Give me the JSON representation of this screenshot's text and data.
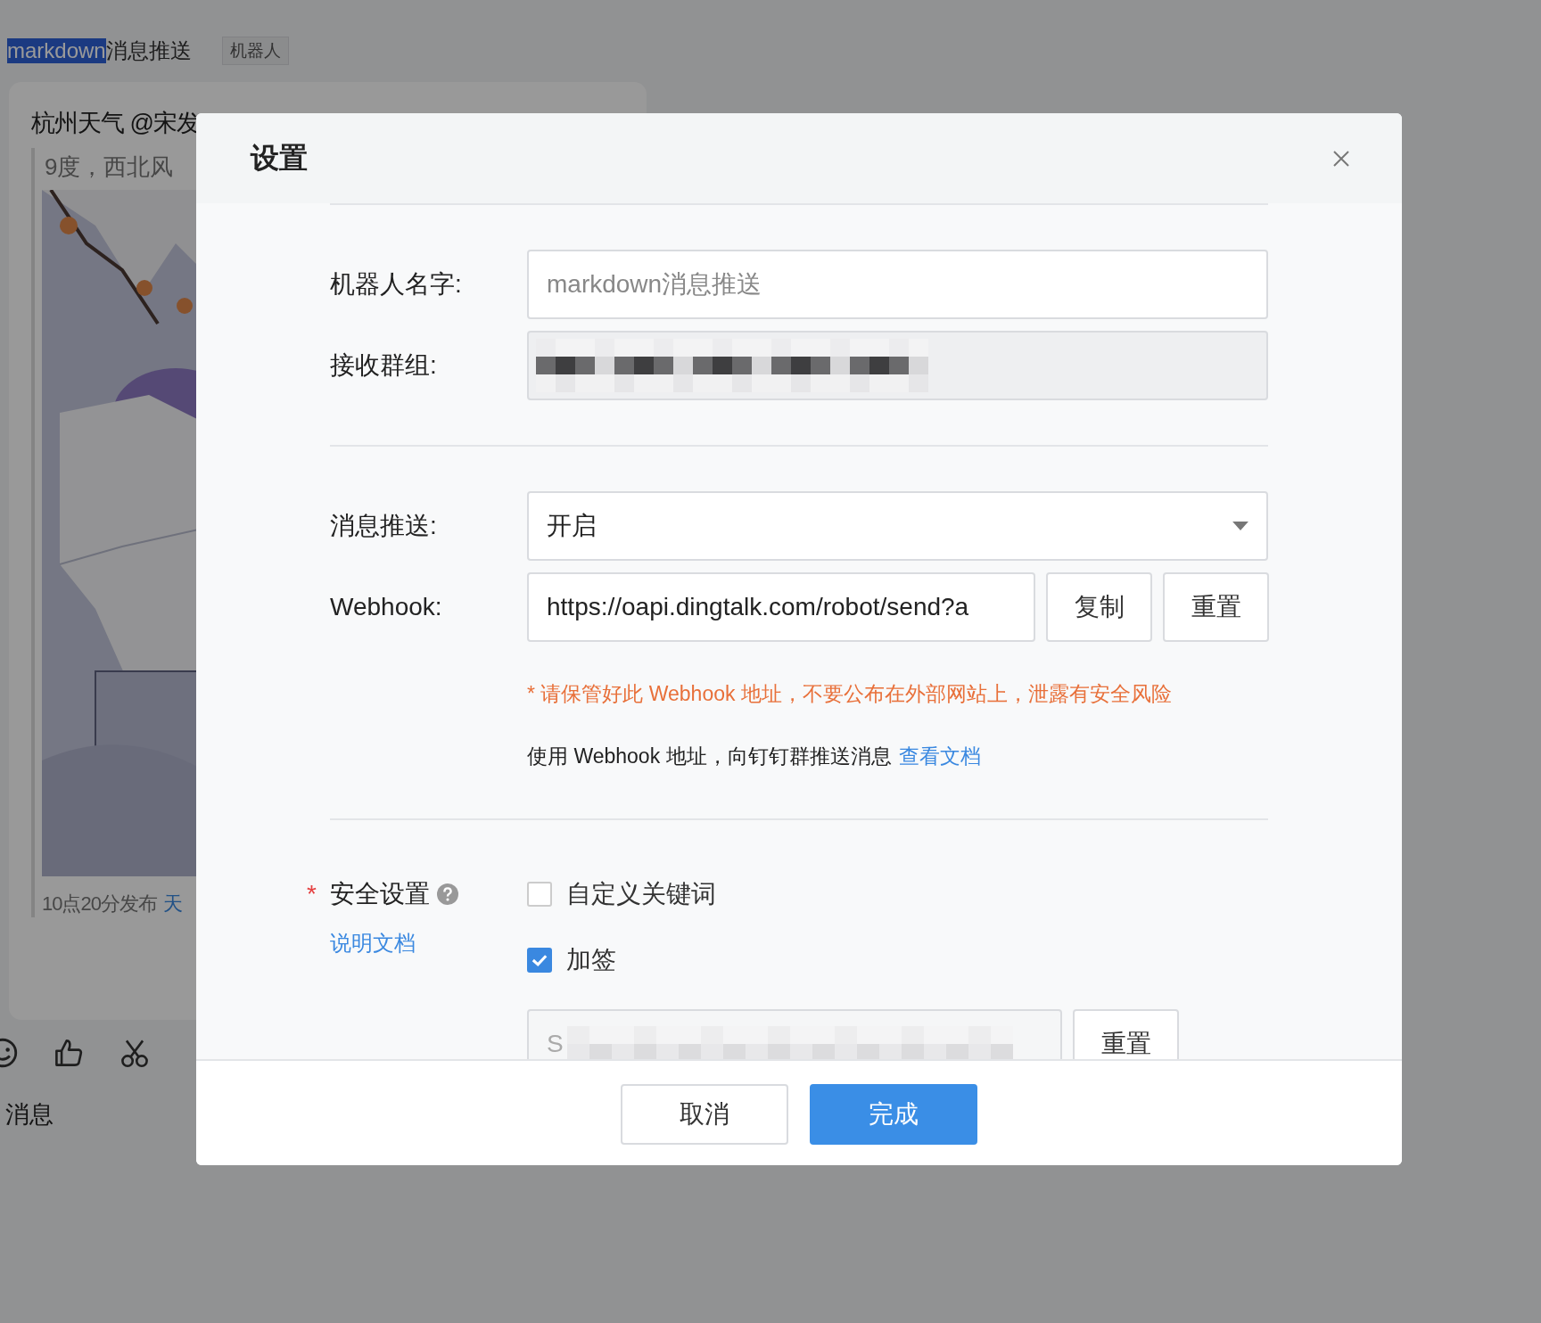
{
  "background_page": {
    "heading": [
      {
        "text": "markdown",
        "selected": true
      },
      {
        "text": "消息推送",
        "selected": false
      }
    ],
    "tag": "机器人",
    "message": {
      "title": "杭州天气 @宋发",
      "text": "9度，西北风",
      "footer": "10点20分发布",
      "footer_link": "天"
    },
    "composer_hint": "消息"
  },
  "dialog": {
    "title": "设置",
    "fields": [
      {
        "kind": "text",
        "label": "机器人名字:",
        "placeholder": "markdown消息推送"
      },
      {
        "kind": "redacted",
        "label": "接收群组:",
        "disabled": true
      }
    ],
    "push": {
      "label": "消息推送:",
      "value": "开启"
    },
    "webhook": {
      "label": "Webhook:",
      "value": "https://oapi.dingtalk.com/robot/send?a",
      "buttons": [
        "复制",
        "重置"
      ],
      "warning": "* 请保管好此 Webhook 地址，不要公布在外部网站上，泄露有安全风险",
      "usage": "使用 Webhook 地址，向钉钉群推送消息",
      "usage_link": "查看文档"
    },
    "security": {
      "label": "安全设置",
      "required_mark": "*",
      "doc_link": "说明文档",
      "options": [
        {
          "label": "自定义关键词",
          "checked": false
        },
        {
          "label": "加签",
          "checked": true
        }
      ],
      "secret_value": "S",
      "secret_button": "重置"
    },
    "footer_buttons": [
      {
        "label": "取消",
        "kind": "default"
      },
      {
        "label": "完成",
        "kind": "primary"
      }
    ]
  }
}
